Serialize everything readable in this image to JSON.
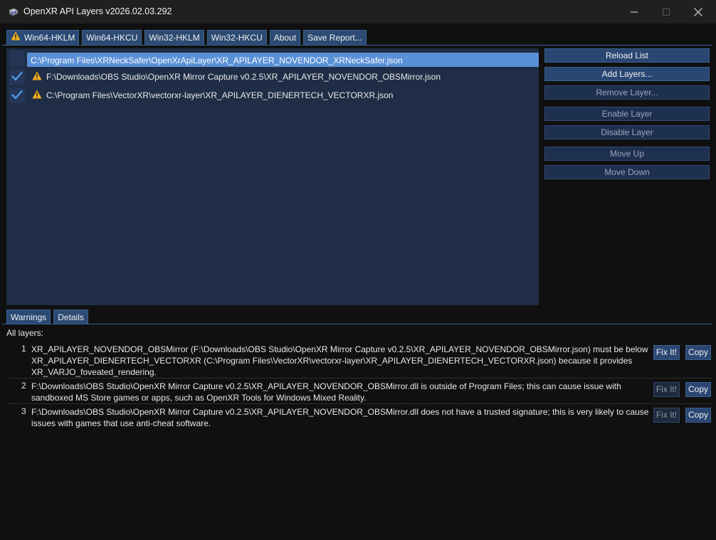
{
  "window": {
    "title": "OpenXR API Layers v2026.02.03.292",
    "icons": {
      "app": "vr-headset-icon",
      "minimize": "minimize-icon",
      "maximize": "maximize-icon",
      "close": "close-icon"
    }
  },
  "tabs": [
    {
      "label": "Win64-HKLM",
      "active": true,
      "warning": true
    },
    {
      "label": "Win64-HKCU"
    },
    {
      "label": "Win32-HKLM"
    },
    {
      "label": "Win32-HKCU"
    },
    {
      "label": "About"
    },
    {
      "label": "Save Report..."
    }
  ],
  "layers": [
    {
      "path": "C:\\Program Files\\XRNeckSafer\\OpenXrApiLayer\\XR_APILAYER_NOVENDOR_XRNeckSafer.json",
      "enabled": false,
      "warning": false,
      "selected": true
    },
    {
      "path": "F:\\Downloads\\OBS Studio\\OpenXR Mirror Capture v0.2.5\\XR_APILAYER_NOVENDOR_OBSMirror.json",
      "enabled": true,
      "warning": true,
      "selected": false
    },
    {
      "path": "C:\\Program Files\\VectorXR\\vectorxr-layer\\XR_APILAYER_DIENERTECH_VECTORXR.json",
      "enabled": true,
      "warning": true,
      "selected": false
    }
  ],
  "actions": {
    "reload": "Reload List",
    "add": "Add Layers...",
    "remove": "Remove Layer...",
    "enable": "Enable Layer",
    "disable": "Disable Layer",
    "move_up": "Move Up",
    "move_down": "Move Down"
  },
  "bottom_tabs": [
    {
      "label": "Warnings",
      "active": true
    },
    {
      "label": "Details"
    }
  ],
  "warnings_header": "All layers:",
  "warnings": [
    {
      "number": "1",
      "text": "XR_APILAYER_NOVENDOR_OBSMirror (F:\\Downloads\\OBS Studio\\OpenXR Mirror Capture v0.2.5\\XR_APILAYER_NOVENDOR_OBSMirror.json) must be below XR_APILAYER_DIENERTECH_VECTORXR (C:\\Program Files\\VectorXR\\vectorxr-layer\\XR_APILAYER_DIENERTECH_VECTORXR.json) because it provides XR_VARJO_foveated_rendering.",
      "fix_label": "Fix It!",
      "fix_enabled": true,
      "copy_label": "Copy"
    },
    {
      "number": "2",
      "text": "F:\\Downloads\\OBS Studio\\OpenXR Mirror Capture v0.2.5\\XR_APILAYER_NOVENDOR_OBSMirror.dll is outside of Program Files; this can cause issue with sandboxed MS Store games or apps, such as OpenXR Tools for Windows Mixed Reality.",
      "fix_label": "Fix It!",
      "fix_enabled": false,
      "copy_label": "Copy"
    },
    {
      "number": "3",
      "text": "F:\\Downloads\\OBS Studio\\OpenXR Mirror Capture v0.2.5\\XR_APILAYER_NOVENDOR_OBSMirror.dll does not have a trusted signature; this is very likely to cause issues with games that use anti-cheat software.",
      "fix_label": "Fix It!",
      "fix_enabled": false,
      "copy_label": "Copy"
    }
  ],
  "colors": {
    "accent": "#2a4773",
    "list_background": "#1f2d46",
    "selection": "#5a90d6",
    "warning": "#f2b01e",
    "check": "#4f9ae8"
  }
}
